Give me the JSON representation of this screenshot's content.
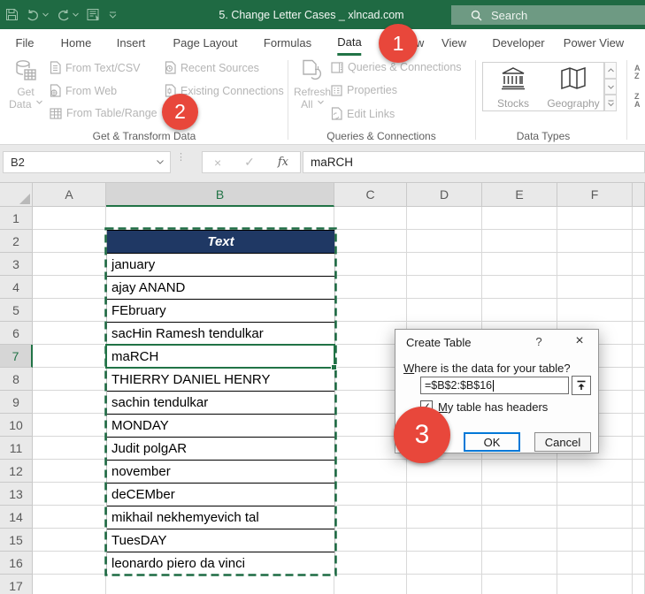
{
  "titlebar": {
    "title": "5. Change Letter Cases _ xlncad.com",
    "search_placeholder": "Search"
  },
  "tabs": {
    "items": [
      "File",
      "Home",
      "Insert",
      "Page Layout",
      "Formulas",
      "Data",
      "Review",
      "View",
      "Developer",
      "Power View"
    ],
    "active": "Data"
  },
  "ribbon": {
    "group1": {
      "big_line1": "Get",
      "big_line2": "Data",
      "items": [
        "From Text/CSV",
        "From Web",
        "From Table/Range"
      ],
      "items2": [
        "Recent Sources",
        "Existing Connections"
      ],
      "label": "Get & Transform Data"
    },
    "group2": {
      "big_line1": "Refresh",
      "big_line2": "All",
      "items": [
        "Queries & Connections",
        "Properties",
        "Edit Links"
      ],
      "label": "Queries & Connections"
    },
    "group3": {
      "items": [
        "Stocks",
        "Geography"
      ],
      "label": "Data Types"
    },
    "sort_partial": {
      "az_top": "A",
      "az_bottom": "Z",
      "za_top": "Z",
      "za_bottom": "A"
    }
  },
  "formula_bar": {
    "name_box": "B2",
    "cancel_glyph": "×",
    "enter_glyph": "✓",
    "fx_label": "fx",
    "formula": "maRCH"
  },
  "sheet": {
    "visible_columns": [
      "A",
      "B",
      "C",
      "D",
      "E",
      "F",
      ""
    ],
    "visible_rows": [
      1,
      2,
      3,
      4,
      5,
      6,
      7,
      8,
      9,
      10,
      11,
      12,
      13,
      14,
      15,
      16,
      17
    ],
    "selected_column": "B",
    "selected_row": 7,
    "selection_range": "B2:B16",
    "active_cell": "B7",
    "cells": [
      {
        "row": 2,
        "text": "Text",
        "header": true
      },
      {
        "row": 3,
        "text": "january"
      },
      {
        "row": 4,
        "text": "ajay ANAND"
      },
      {
        "row": 5,
        "text": "FEbruary"
      },
      {
        "row": 6,
        "text": "sacHin Ramesh tendulkar"
      },
      {
        "row": 7,
        "text": "maRCH",
        "active": true
      },
      {
        "row": 8,
        "text": "THIERRY DANIEL HENRY"
      },
      {
        "row": 9,
        "text": "sachin tendulkar"
      },
      {
        "row": 10,
        "text": "MONDAY"
      },
      {
        "row": 11,
        "text": "Judit polgAR"
      },
      {
        "row": 12,
        "text": "november"
      },
      {
        "row": 13,
        "text": "deCEMber"
      },
      {
        "row": 14,
        "text": "mikhail nekhemyevich tal"
      },
      {
        "row": 15,
        "text": "TuesDAY"
      },
      {
        "row": 16,
        "text": "leonardo piero da vinci"
      }
    ]
  },
  "dialog": {
    "title": "Create Table",
    "help_glyph": "?",
    "close_glyph": "×",
    "prompt_mnemonic": "W",
    "prompt_rest": "here is the data for your table?",
    "range_value": "=$B$2:$B$16",
    "checkbox_mnemonic": "M",
    "checkbox_rest": "y table has headers",
    "checkbox_checked": "✓",
    "ok_label": "OK",
    "cancel_label": "Cancel"
  },
  "annotations": {
    "step1": "1",
    "step2": "2",
    "step3": "3"
  },
  "colors": {
    "excel_green": "#217346",
    "titlebar_green": "#1F6A43",
    "table_header_navy": "#1F3864",
    "annotation_red": "#E8473B",
    "ok_button_border": "#0078D7"
  }
}
